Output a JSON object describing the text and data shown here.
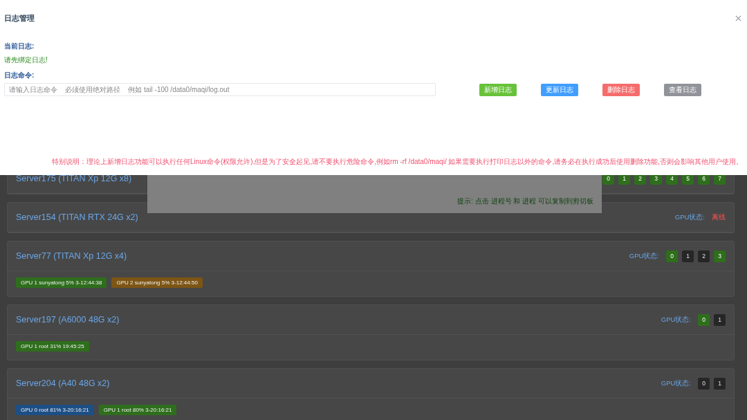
{
  "modal": {
    "title": "日志管理",
    "current_log_label": "当前日志:",
    "current_log_value": "请先绑定日志!",
    "command_label": "日志命令:",
    "command_field": {
      "placeholder": "请输入日志命令    必须使用绝对路径    例如 tail -100 /data0/maqi/log.out"
    },
    "buttons": [
      {
        "label": "新增日志",
        "color": "#67c23a"
      },
      {
        "label": "更新日志",
        "color": "#409eff"
      },
      {
        "label": "删除日志",
        "color": "#f56c6c"
      },
      {
        "label": "查看日志",
        "color": "#909399"
      }
    ],
    "note": "特别说明：理论上新增日志功能可以执行任何Linux命令(权限允许),但是为了安全起见,请不要执行危险命令,例如rm -rf /data0/maqi/ 如果需要执行打印日志以外的命令,请务必在执行成功后使用删除功能,否则会影响其他用户使用。"
  },
  "hint_dialog": {
    "hint": "提示: 点击 进程号 和 进程 可以复制到剪切板"
  },
  "servers": [
    {
      "name": "Server175 (TITAN Xp 12G x8)",
      "gpus": [
        {
          "label": "0",
          "busy": false
        },
        {
          "label": "1",
          "busy": false
        },
        {
          "label": "2",
          "busy": false
        },
        {
          "label": "3",
          "busy": false
        },
        {
          "label": "4",
          "busy": false
        },
        {
          "label": "5",
          "busy": false
        },
        {
          "label": "6",
          "busy": false
        },
        {
          "label": "7",
          "busy": false
        }
      ]
    },
    {
      "name": "Server154 (TITAN RTX 24G x2)",
      "status_label": "GPU状态:",
      "offline_text": "离线"
    },
    {
      "name": "Server77 (TITAN Xp 12G x4)",
      "status_label": "GPU状态:",
      "gpus": [
        {
          "label": "0",
          "busy": false
        },
        {
          "label": "1",
          "busy": true
        },
        {
          "label": "2",
          "busy": true
        },
        {
          "label": "3",
          "busy": false
        }
      ],
      "tags": [
        {
          "text": "GPU 1 sunyatong 5% 3-12:44:38",
          "color": "#2e6e1c"
        },
        {
          "text": "GPU 2 sunyatong 5% 3-12:44:50",
          "color": "#7d5514"
        }
      ]
    },
    {
      "name": "Server197 (A6000 48G x2)",
      "status_label": "GPU状态:",
      "gpus": [
        {
          "label": "0",
          "busy": false
        },
        {
          "label": "1",
          "busy": true
        }
      ],
      "tags": [
        {
          "text": "GPU 1 root 31% 19:45:25",
          "color": "#2e6e1c"
        }
      ]
    },
    {
      "name": "Server204 (A40 48G x2)",
      "status_label": "GPU状态:",
      "gpus": [
        {
          "label": "0",
          "busy": true
        },
        {
          "label": "1",
          "busy": true
        }
      ],
      "tags": [
        {
          "text": "GPU 0 root 81% 3-20:16:21",
          "color": "#1d4f86"
        },
        {
          "text": "GPU 1 root 80% 3-20:16:21",
          "color": "#2e6e1c"
        }
      ]
    }
  ]
}
